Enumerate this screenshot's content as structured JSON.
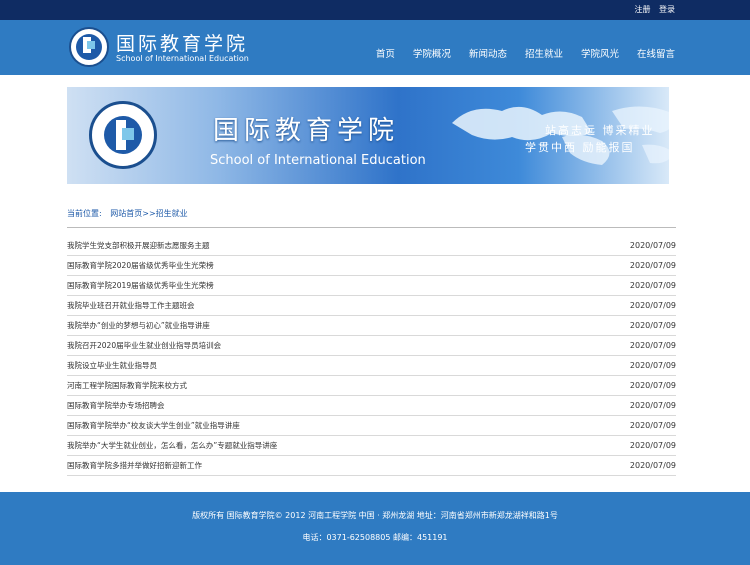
{
  "topbar": {
    "register": "注册",
    "login": "登录"
  },
  "header": {
    "title_cn": "国际教育学院",
    "title_en": "School of International Education",
    "nav": [
      "首页",
      "学院概况",
      "新闻动态",
      "招生就业",
      "学院风光",
      "在线留言"
    ]
  },
  "banner": {
    "title_cn": "国际教育学院",
    "title_en": "School of International Education",
    "motto_line1": "站高志远  博采精业",
    "motto_line2": "学贯中西  励能报国"
  },
  "breadcrumb": {
    "label": "当前位置:",
    "home": "网站首页>>",
    "current": "招生就业"
  },
  "list": [
    {
      "title": "我院学生党支部积极开展迎新志愿服务主题",
      "date": "2020/07/09"
    },
    {
      "title": "国际教育学院2020届省级优秀毕业生光荣榜",
      "date": "2020/07/09"
    },
    {
      "title": "国际教育学院2019届省级优秀毕业生光荣榜",
      "date": "2020/07/09"
    },
    {
      "title": "我院毕业班召开就业指导工作主题班会",
      "date": "2020/07/09"
    },
    {
      "title": "我院举办“创业的梦想与初心”就业指导讲座",
      "date": "2020/07/09"
    },
    {
      "title": "我院召开2020届毕业生就业创业指导员培训会",
      "date": "2020/07/09"
    },
    {
      "title": "我院设立毕业生就业指导员",
      "date": "2020/07/09"
    },
    {
      "title": "河南工程学院国际教育学院来校方式",
      "date": "2020/07/09"
    },
    {
      "title": "国际教育学院举办专场招聘会",
      "date": "2020/07/09"
    },
    {
      "title": "国际教育学院举办“校友谈大学生创业”就业指导讲座",
      "date": "2020/07/09"
    },
    {
      "title": "我院举办“大学生就业创业，怎么看，怎么办”专题就业指导讲座",
      "date": "2020/07/09"
    },
    {
      "title": "国际教育学院多措并举做好招新迎新工作",
      "date": "2020/07/09"
    }
  ],
  "footer": {
    "line1": "版权所有 国际教育学院© 2012 河南工程学院 中国 · 郑州龙湖  地址：河南省郑州市新郑龙湖祥和路1号",
    "line2": "电话：0371-62508805  邮编：451191"
  },
  "colors": {
    "topbar": "#0f2c63",
    "header": "#2f7bc2",
    "link": "#1e5aa8"
  },
  "icons": {
    "logo": "school-emblem-icon"
  }
}
